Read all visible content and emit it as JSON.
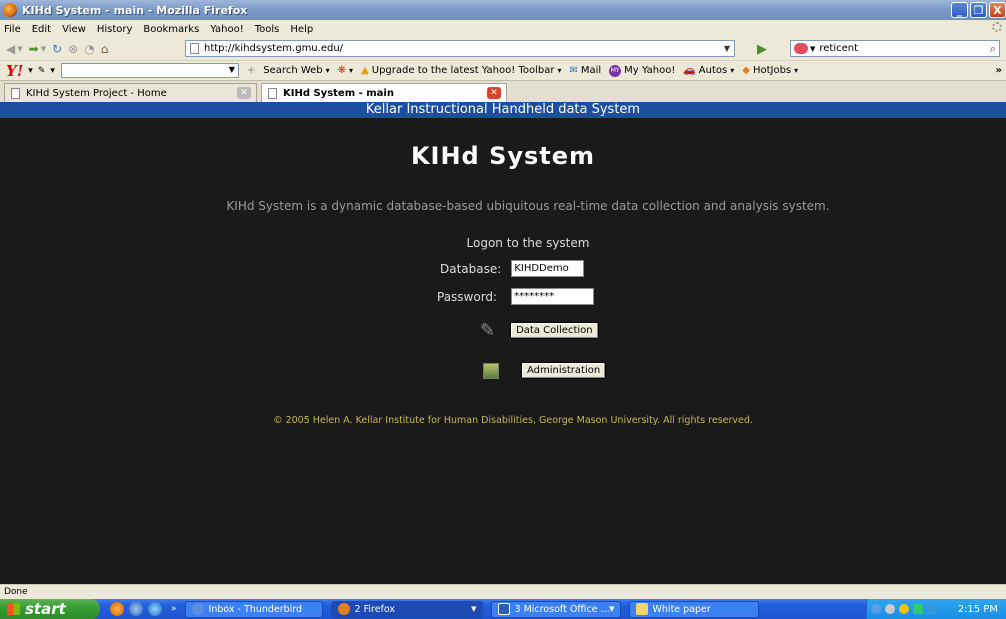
{
  "window": {
    "title": "KIHd System - main - Mozilla Firefox",
    "buttons": [
      "_",
      "❐",
      "X"
    ]
  },
  "menu": [
    "File",
    "Edit",
    "View",
    "History",
    "Bookmarks",
    "Yahoo!",
    "Tools",
    "Help"
  ],
  "nav": {
    "url": "http://kihdsystem.gmu.edu/",
    "search_value": "reticent"
  },
  "yahoo_toolbar": {
    "logo": "Y!",
    "search_web": "Search Web",
    "upgrade": "Upgrade to the latest Yahoo! Toolbar",
    "mail": "Mail",
    "my_yahoo": "My Yahoo!",
    "autos": "Autos",
    "hotjobs": "HotJobs",
    "overflow": "»"
  },
  "tabs": [
    {
      "label": "KIHd System Project - Home",
      "active": false
    },
    {
      "label": "KIHd System - main",
      "active": true
    }
  ],
  "page": {
    "banner": "Kellar Instructional Handheld data System",
    "heading": "KIHd System",
    "description": "KIHd System is a dynamic database-based ubiquitous real-time data collection and analysis system.",
    "logon_title": "Logon to the system",
    "database_label": "Database:",
    "database_value": "KIHDDemo",
    "password_label": "Password:",
    "password_value": "********",
    "data_collection_label": "Data Collection",
    "administration_label": "Administration",
    "copyright": "© 2005 Helen A. Kellar Institute for Human Disabilities, George Mason University. All rights reserved."
  },
  "status": "Done",
  "taskbar": {
    "start": "start",
    "items": [
      {
        "label": "Inbox - Thunderbird",
        "active": false
      },
      {
        "label": "2 Firefox",
        "active": true
      },
      {
        "label": "3 Microsoft Office ...",
        "active": false
      },
      {
        "label": "White paper",
        "active": false
      }
    ],
    "more": "»",
    "clock": "2:15 PM"
  },
  "colors": {
    "page_bg": "#1A1A1A",
    "banner_bg": "#1D4FA0",
    "copyright_text": "#C9B550"
  }
}
